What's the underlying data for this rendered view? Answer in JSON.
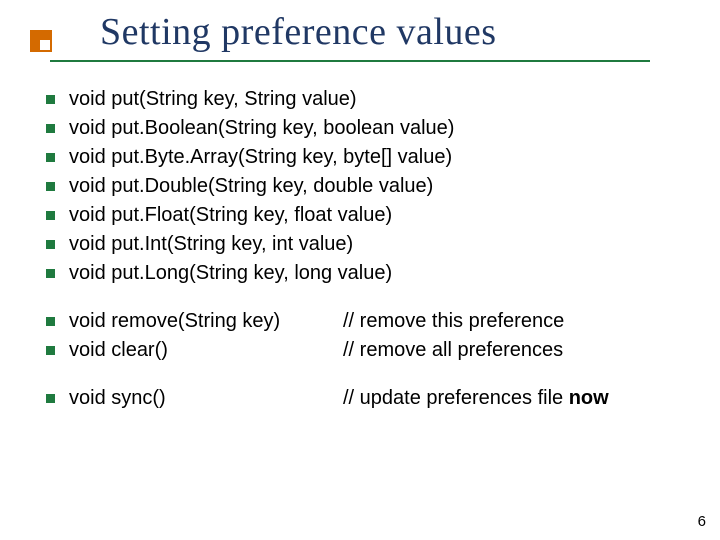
{
  "title": "Setting preference values",
  "group1": [
    "void put(String key, String value)",
    "void put.Boolean(String key, boolean value)",
    "void put.Byte.Array(String key, byte[] value)",
    "void put.Double(String key, double value)",
    "void put.Float(String key, float value)",
    "void put.Int(String key, int value)",
    "void put.Long(String key, long value)"
  ],
  "group2": [
    {
      "left": "void remove(String key)",
      "right": "// remove this preference"
    },
    {
      "left": "void clear()",
      "right": "// remove all preferences"
    }
  ],
  "group3": [
    {
      "left": "void sync()",
      "right_prefix": "// update preferences file ",
      "right_bold": "now"
    }
  ],
  "page_number": "6"
}
